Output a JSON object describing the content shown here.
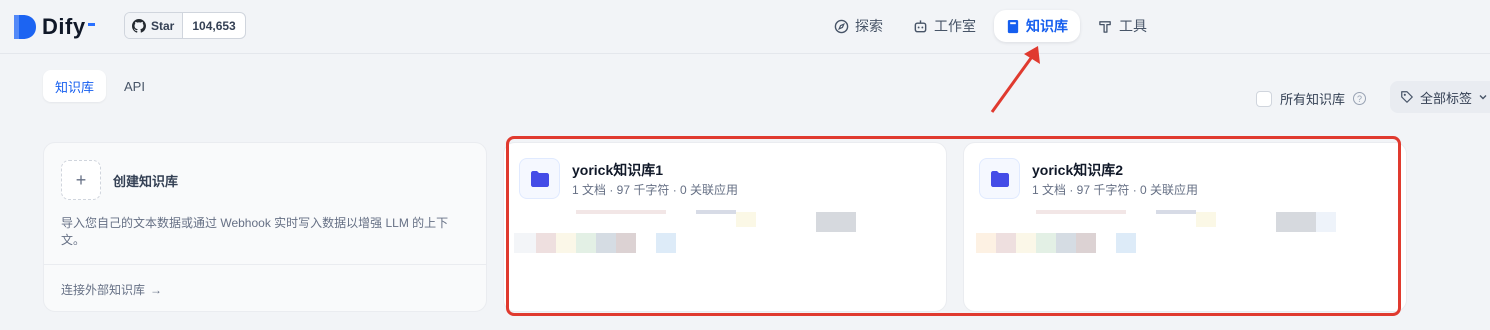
{
  "brand": {
    "name": "Dify",
    "accent": "#155eef"
  },
  "github": {
    "star_label": "Star",
    "star_count": "104,653"
  },
  "nav": {
    "explore": "探索",
    "studio": "工作室",
    "knowledge": "知识库",
    "tools": "工具"
  },
  "tabs": {
    "knowledge": "知识库",
    "api": "API"
  },
  "filters": {
    "all_knowledge": "所有知识库",
    "help": "?",
    "all_tags": "全部标签"
  },
  "create_card": {
    "plus": "+",
    "title": "创建知识库",
    "description": "导入您自己的文本数据或通过 Webhook 实时写入数据以增强 LLM 的上下文。",
    "external_link": "连接外部知识库",
    "external_arrow": "→"
  },
  "datasets": [
    {
      "name": "yorick知识库1",
      "meta": "1 文档 · 97 千字符 · 0 关联应用"
    },
    {
      "name": "yorick知识库2",
      "meta": "1 文档 · 97 千字符 · 0 关联应用"
    }
  ],
  "annotation_color": "#e03a2f"
}
